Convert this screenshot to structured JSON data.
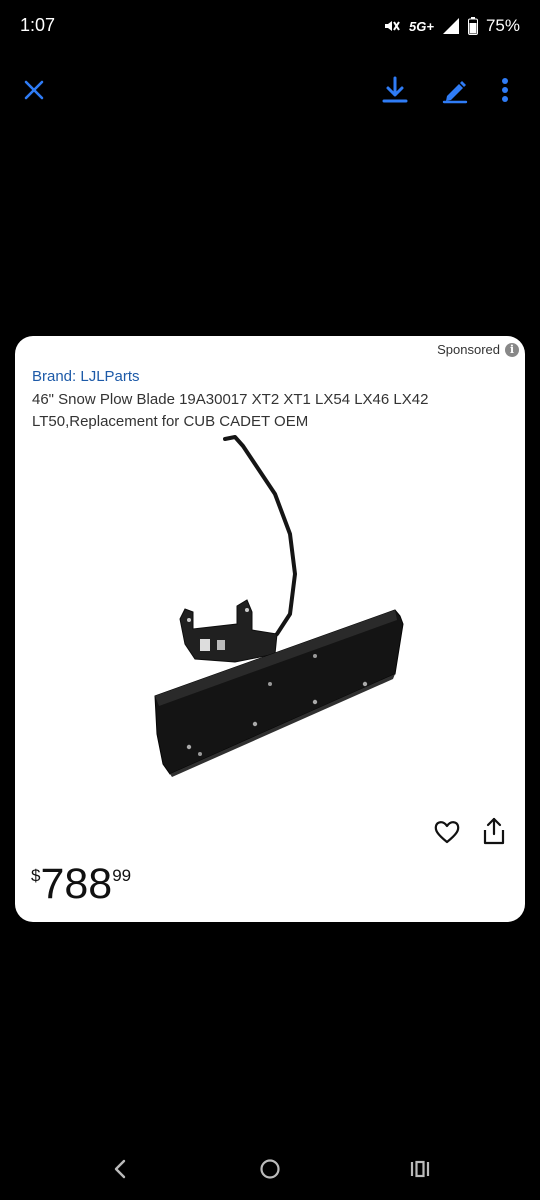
{
  "status_bar": {
    "time": "1:07",
    "network": "5G+",
    "battery": "75%"
  },
  "toolbar": {
    "close_icon": "close-icon",
    "download_icon": "download-icon",
    "edit_icon": "edit-icon",
    "more_icon": "more-vert-icon",
    "accent_color": "#2f7cf6"
  },
  "ad_card": {
    "sponsored_label": "Sponsored",
    "brand": "Brand: LJLParts",
    "title": "46\" Snow Plow Blade 19A30017 XT2 XT1 LX54 LX46 LX42 LT50,Replacement for CUB CADET OEM",
    "price_symbol": "$",
    "price_main": "788",
    "price_cents": "99",
    "brand_color": "#1d5aa8"
  },
  "nav_bar": {
    "back_icon": "back-icon",
    "home_icon": "home-icon",
    "recents_icon": "recents-icon"
  }
}
